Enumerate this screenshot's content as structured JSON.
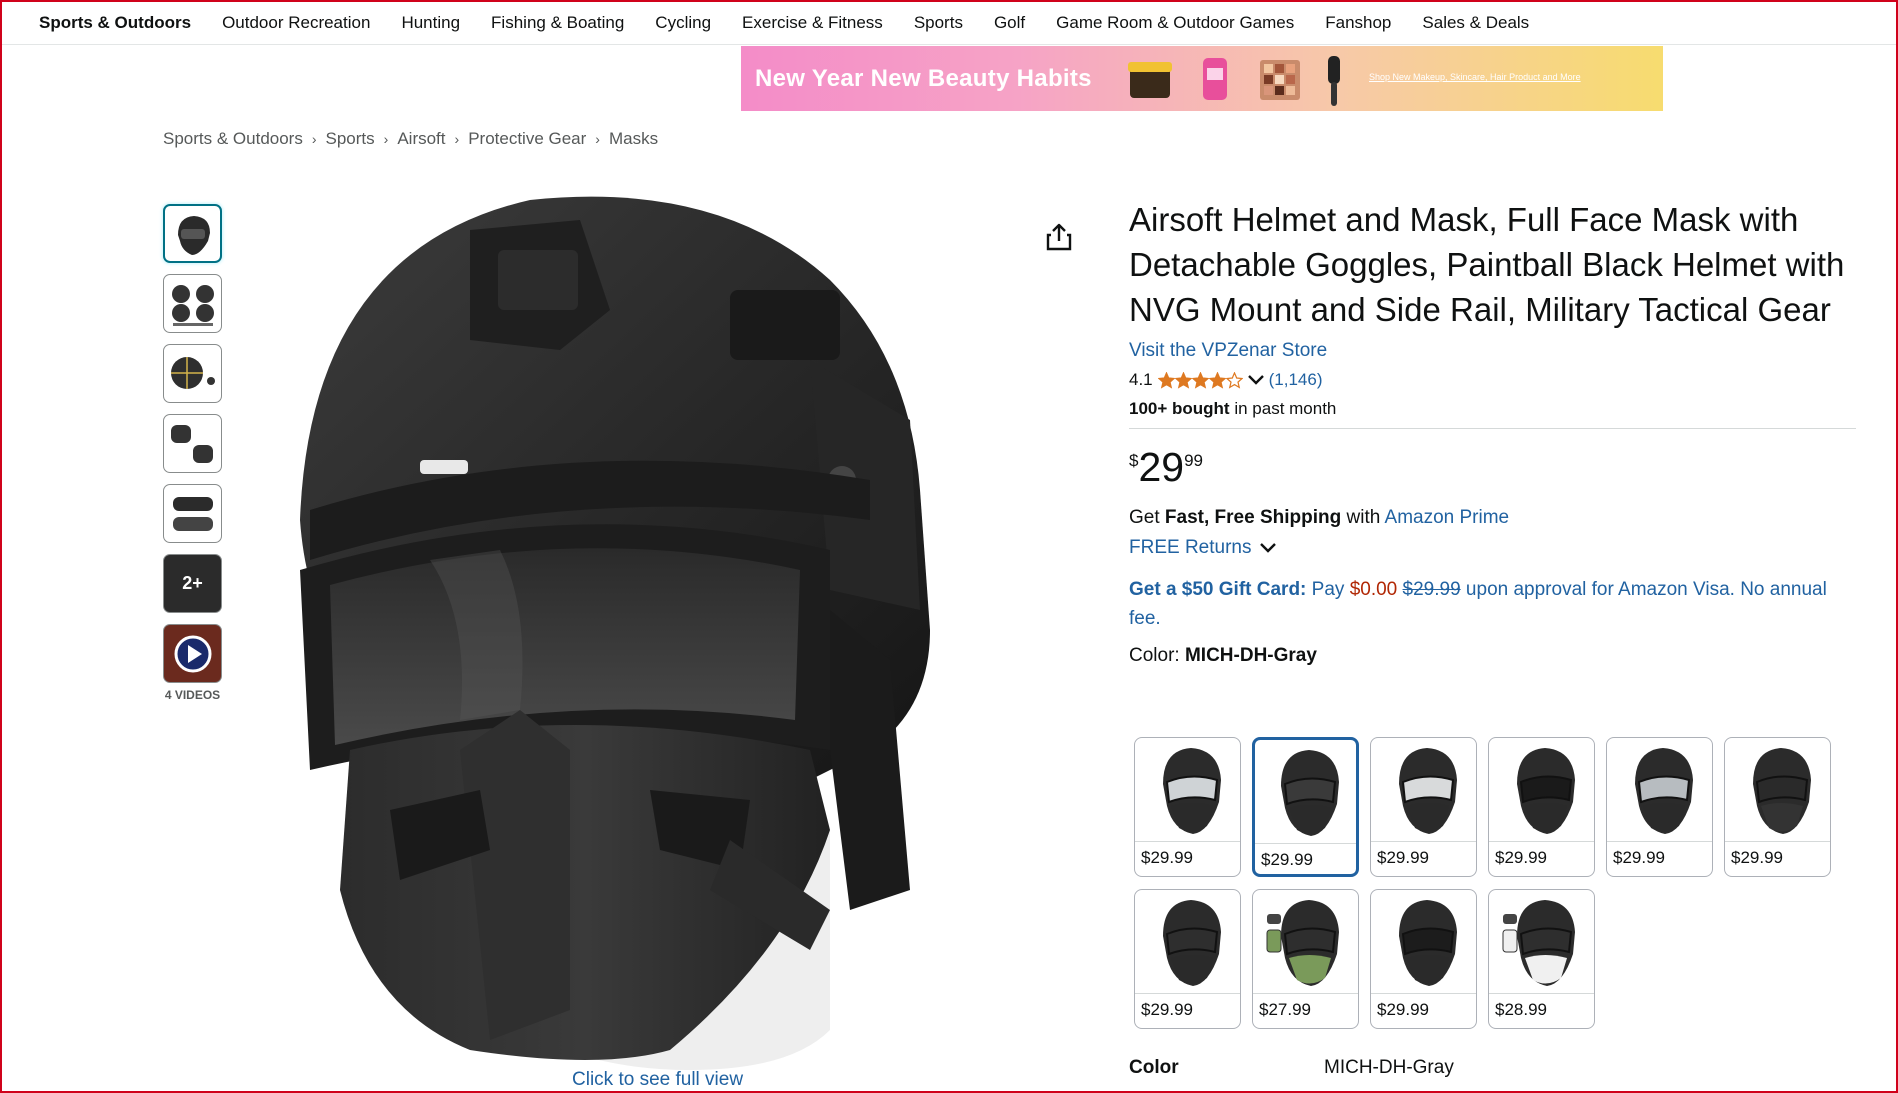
{
  "topnav": {
    "items": [
      "Sports & Outdoors",
      "Outdoor Recreation",
      "Hunting",
      "Fishing & Boating",
      "Cycling",
      "Exercise & Fitness",
      "Sports",
      "Golf",
      "Game Room & Outdoor Games",
      "Fanshop",
      "Sales & Deals"
    ]
  },
  "banner": {
    "headline": "New Year New Beauty Habits",
    "subtext": "Shop New Makeup, Skincare, Hair Product and More"
  },
  "breadcrumb": [
    "Sports & Outdoors",
    "Sports",
    "Airsoft",
    "Protective Gear",
    "Masks"
  ],
  "gallery": {
    "more_label": "2+",
    "videos_label": "4 VIDEOS",
    "full_view_label": "Click to see full view"
  },
  "product": {
    "title": "Airsoft Helmet and Mask, Full Face Mask with Detachable Goggles, Paintball Black Helmet with NVG Mount and Side Rail, Military Tactical Gear",
    "store_link": "Visit the VPZenar Store",
    "rating": "4.1",
    "rating_value": 4.1,
    "rating_count": "(1,146)",
    "bought_bold": "100+ bought",
    "bought_rest": " in past month",
    "price_symbol": "$",
    "price_whole": "29",
    "price_fraction": "99",
    "shipping_pre": "Get ",
    "shipping_bold": "Fast, Free Shipping",
    "shipping_mid": " with ",
    "shipping_link": "Amazon Prime",
    "returns": "FREE Returns",
    "gift_bold": "Get a $50 Gift Card:",
    "gift_pay": " Pay ",
    "gift_zero": "$0.00",
    "gift_strike": "$29.99",
    "gift_rest": " upon approval for Amazon Visa. No annual fee.",
    "color_label": "Color: ",
    "color_value": "MICH-DH-Gray"
  },
  "swatches": [
    {
      "price": "$29.99",
      "selected": false
    },
    {
      "price": "$29.99",
      "selected": true
    },
    {
      "price": "$29.99",
      "selected": false
    },
    {
      "price": "$29.99",
      "selected": false
    },
    {
      "price": "$29.99",
      "selected": false
    },
    {
      "price": "$29.99",
      "selected": false
    },
    {
      "price": "$29.99",
      "selected": false
    },
    {
      "price": "$27.99",
      "selected": false
    },
    {
      "price": "$29.99",
      "selected": false
    },
    {
      "price": "$28.99",
      "selected": false
    }
  ],
  "spec": {
    "key": "Color",
    "value": "MICH-DH-Gray"
  },
  "colors": {
    "link": "#2162a1",
    "price_red": "#b12704",
    "star": "#de7921",
    "selected_border": "#2162a1"
  }
}
